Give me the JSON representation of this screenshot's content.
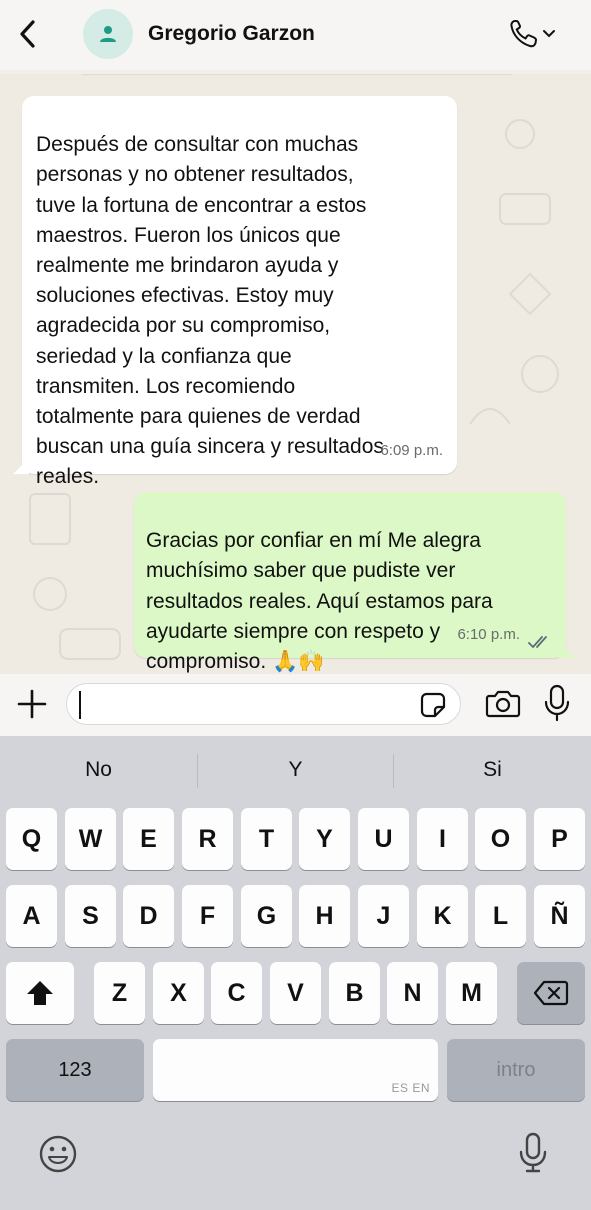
{
  "header": {
    "contact_name": "Gregorio Garzon"
  },
  "messages": [
    {
      "direction": "incoming",
      "text": "Después de consultar con muchas\npersonas y no obtener resultados,\ntuve la fortuna de encontrar a estos\nmaestros. Fueron los únicos que\nrealmente me brindaron ayuda y\nsoluciones efectivas. Estoy muy\nagradecida por su compromiso,\nseriedad y la confianza que\ntransmiten. Los recomiendo\ntotalmente para quienes de verdad\nbuscan una guía sincera y resultados\nreales.",
      "time": "6:09 p.m."
    },
    {
      "direction": "outgoing",
      "text": "Gracias por confiar en mí Me alegra\nmuchísimo saber que pudiste ver\nresultados reales. Aquí estamos para\nayudarte siempre con respeto y\ncompromiso. 🙏🙌",
      "time": "6:10 p.m.",
      "status": "read"
    }
  ],
  "composer": {
    "value": "",
    "placeholder": ""
  },
  "keyboard": {
    "suggestions": [
      "No",
      "Y",
      "Si"
    ],
    "row1": [
      "Q",
      "W",
      "E",
      "R",
      "T",
      "Y",
      "U",
      "I",
      "O",
      "P"
    ],
    "row2": [
      "A",
      "S",
      "D",
      "F",
      "G",
      "H",
      "J",
      "K",
      "L",
      "Ñ"
    ],
    "row3": [
      "Z",
      "X",
      "C",
      "V",
      "B",
      "N",
      "M"
    ],
    "numbers_label": "123",
    "space_hint": "ES EN",
    "return_label": "intro"
  },
  "colors": {
    "outgoing_bubble": "#dbf8c6",
    "incoming_bubble": "#ffffff",
    "chat_background": "#efeae2",
    "avatar_bg": "#d5ece6",
    "avatar_fg": "#1c9c86",
    "read_ticks": "#5a6e7a"
  },
  "icons": {
    "back": "chevron-left-icon",
    "avatar": "person-icon",
    "call": "phone-icon",
    "attach": "plus-icon",
    "sticker": "sticker-icon",
    "camera": "camera-icon",
    "mic": "microphone-icon",
    "shift": "shift-arrow-icon",
    "backspace": "backspace-icon",
    "emoji": "emoji-icon",
    "dictation": "dictation-mic-icon"
  }
}
